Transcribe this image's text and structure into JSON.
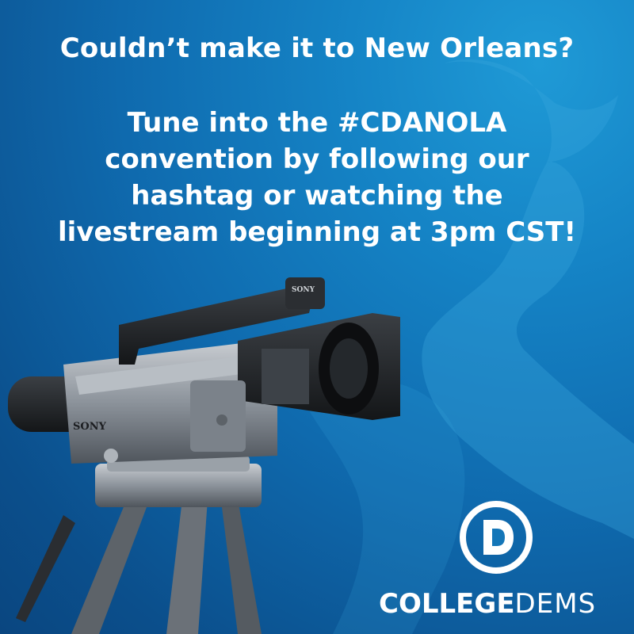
{
  "header": {
    "headline": "Couldn’t make it to New Orleans?",
    "body_lines": [
      "Tune into the #CDANOLA",
      "convention by following our",
      "hashtag or watching the",
      "livestream beginning at 3pm CST!"
    ]
  },
  "camera": {
    "brand_top": "SONY",
    "brand_side": "SONY"
  },
  "logo": {
    "letter": "D",
    "brand_bold": "COLLEGE",
    "brand_light": "DEMS"
  },
  "colors": {
    "background_light": "#1f9ad6",
    "background_dark": "#0a4680",
    "text": "#ffffff"
  }
}
